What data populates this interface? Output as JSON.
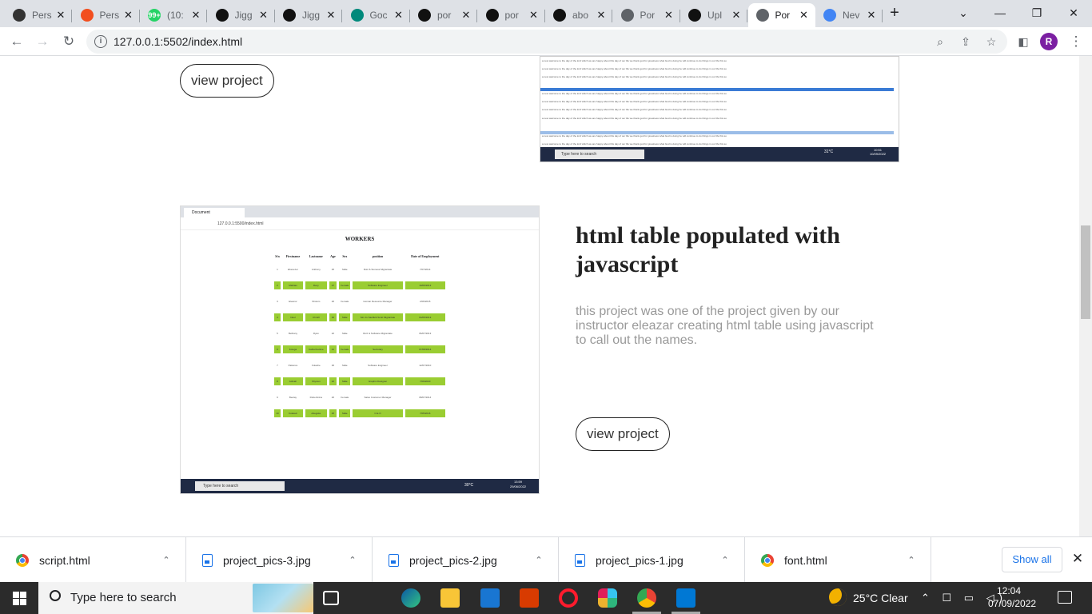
{
  "browser": {
    "tabs": [
      {
        "title": "Pers",
        "icon": "portfolio-icon"
      },
      {
        "title": "Pers",
        "icon": "figma-icon"
      },
      {
        "title": "(10:",
        "icon": "whatsapp-icon"
      },
      {
        "title": "Jigg",
        "icon": "github-icon"
      },
      {
        "title": "Jigg",
        "icon": "github-icon"
      },
      {
        "title": "Goc",
        "icon": "google-meet-icon"
      },
      {
        "title": "por",
        "icon": "github-icon"
      },
      {
        "title": "por",
        "icon": "github-icon"
      },
      {
        "title": "abo",
        "icon": "github-icon"
      },
      {
        "title": "Por",
        "icon": "globe-icon"
      },
      {
        "title": "Upl",
        "icon": "github-icon"
      },
      {
        "title": "Por",
        "icon": "globe-icon",
        "active": true
      },
      {
        "title": "Nev",
        "icon": "chrome-icon"
      }
    ],
    "url": "127.0.0.1:5502/index.html",
    "profile_initial": "R"
  },
  "page": {
    "project1": {
      "button": "view project"
    },
    "project2": {
      "title": "html table populated with javascript",
      "description": "this project was one of the project given by our instructor eleazar creating html table using javascript to call out the names.",
      "button": "view project"
    },
    "screenshot1": {
      "line_text": "a new welcome to the day of the lord which we are happy about this day of our life we thank god for greatness what God is doing he will continue to do things in our life this so",
      "search_placeholder": "Type here to search",
      "time": "10:51",
      "date": "10/09/2022",
      "temp": "31°C"
    },
    "screenshot2": {
      "tab_title": "Document",
      "address": "127.0.0.1:5500/index.html",
      "heading": "WORKERS",
      "columns": [
        "S/n",
        "Firstname",
        "Lastname",
        "Age",
        "Sex",
        "position",
        "Date of Employment"
      ],
      "rows": [
        [
          "1",
          "Ebenezer",
          "Anthony",
          "25",
          "Male",
          "Ruiz & Stoness Migrantate",
          "7/07/2014"
        ],
        [
          "2",
          "Mathias",
          "Rexy",
          "27",
          "Female",
          "Software Engineer",
          "10/05/2013"
        ],
        [
          "3",
          "Eleanor",
          "Sholom",
          "26",
          "Female",
          "Human Resource Manager",
          "2/06/2015"
        ],
        [
          "4",
          "Noel",
          "Chrofil",
          "30",
          "Male",
          "Sim Js Sauffeld Scott Migrantate",
          "04/05/2013"
        ],
        [
          "5",
          "Bethany",
          "Ryan",
          "22",
          "Male",
          "Ruiz & Software Migrantate",
          "06/07/2013"
        ],
        [
          "6",
          "Fotega",
          "Catherinetime",
          "21",
          "Female",
          "Secretary",
          "07/08/2014"
        ],
        [
          "7",
          "Patience",
          "Folashe",
          "36",
          "Male",
          "Software Engineer",
          "12/07/2010"
        ],
        [
          "8",
          "Adinah",
          "Shyvien",
          "22",
          "Male",
          "Graphic Designer",
          "7/09/2020"
        ],
        [
          "9",
          "Beolay",
          "Robertinina",
          "26",
          "Female",
          "Sales Customer Manager",
          "08/07/2014"
        ],
        [
          "10",
          "Kolasuti",
          "Adegoke",
          "25",
          "Male",
          "C.E.O",
          "7/05/2016"
        ]
      ],
      "search_placeholder": "Type here to search",
      "time": "13:59",
      "date": "29/06/2022",
      "temp": "30°C"
    }
  },
  "downloads": {
    "items": [
      {
        "name": "script.html",
        "type": "chrome"
      },
      {
        "name": "project_pics-3.jpg",
        "type": "file"
      },
      {
        "name": "project_pics-2.jpg",
        "type": "file"
      },
      {
        "name": "project_pics-1.jpg",
        "type": "file"
      },
      {
        "name": "font.html",
        "type": "chrome"
      }
    ],
    "show_all": "Show all"
  },
  "taskbar": {
    "search_placeholder": "Type here to search",
    "weather": "25°C  Clear",
    "time": "12:04",
    "date": "07/09/2022",
    "apps": [
      "task-view-icon",
      "edge-icon",
      "file-explorer-icon",
      "mail-icon",
      "office-icon",
      "opera-icon",
      "slack-icon",
      "chrome-icon",
      "vscode-icon"
    ]
  },
  "colors": {
    "accent_green": "#9acd32",
    "chrome_purple": "#7b1fa2",
    "link_blue": "#1a73e8"
  }
}
